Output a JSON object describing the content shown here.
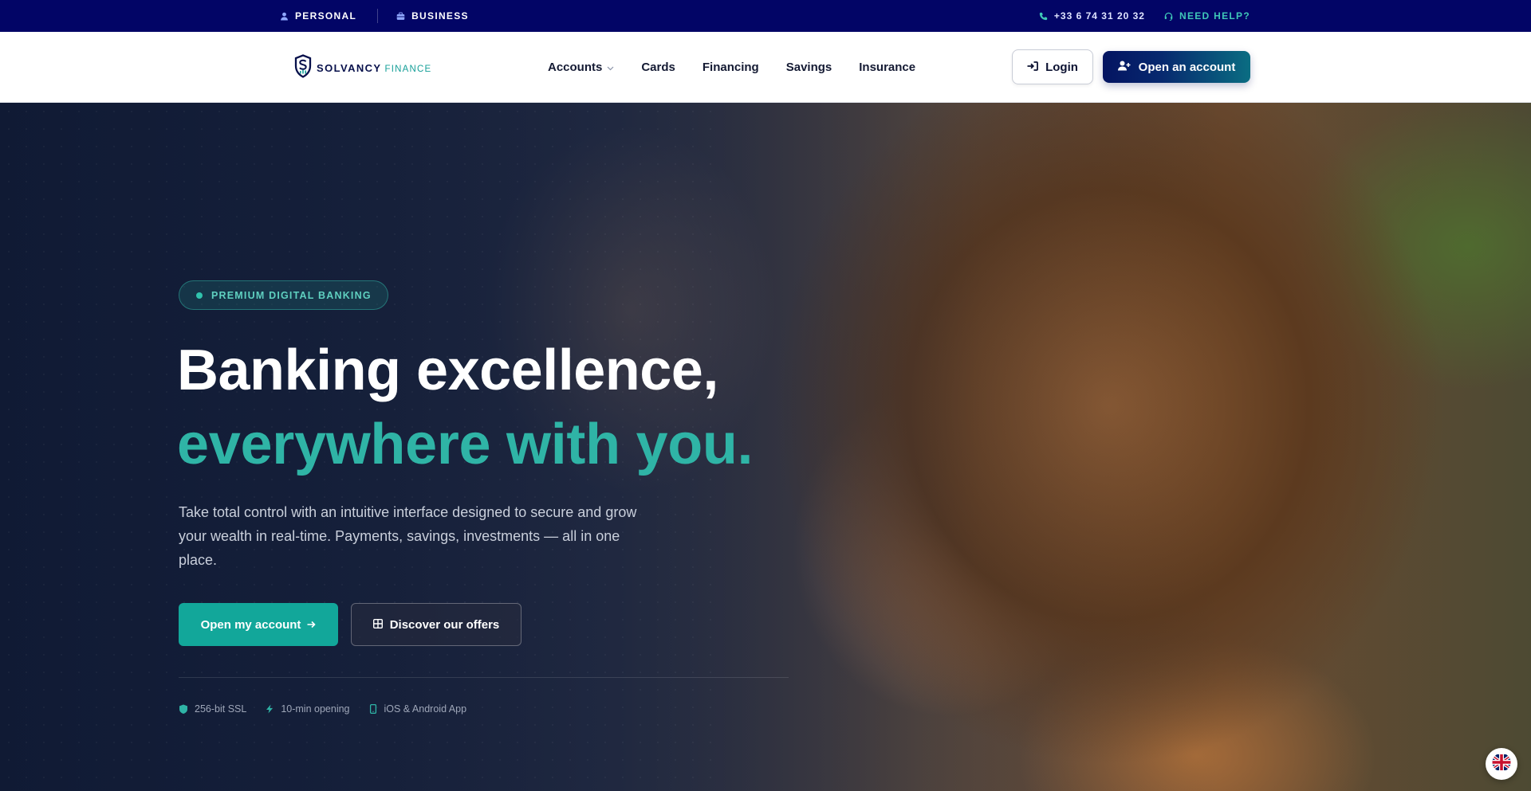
{
  "topbar": {
    "personal": "PERSONAL",
    "business": "BUSINESS",
    "phone": "+33 6 74 31 20 32",
    "help": "NEED HELP?"
  },
  "nav": {
    "logo_primary": "SOLVANCY",
    "logo_secondary": "FINANCE",
    "menu": [
      "Accounts",
      "Cards",
      "Financing",
      "Savings",
      "Insurance"
    ],
    "login": "Login",
    "open_account": "Open an account"
  },
  "hero": {
    "badge": "PREMIUM DIGITAL BANKING",
    "title_line1": "Banking excellence,",
    "title_line2": "everywhere with you.",
    "lead": "Take total control with an intuitive interface designed to secure and grow your wealth in real-time. Payments, savings, investments — all in one place.",
    "cta_primary": "Open my account",
    "cta_secondary": "Discover our offers",
    "features": [
      "256-bit SSL",
      "10-min opening",
      "iOS & Android App"
    ]
  },
  "icons": {
    "personal": "user-icon",
    "business": "briefcase-icon",
    "phone": "phone-icon",
    "help": "headset-icon",
    "login": "sign-in-icon",
    "open_account": "user-plus-icon",
    "cta_primary": "arrow-right-icon",
    "cta_secondary": "grid-icon",
    "features": [
      "shield-icon",
      "bolt-icon",
      "mobile-icon"
    ],
    "language": "uk-flag-icon"
  },
  "colors": {
    "topbar": "#020566",
    "accent": "#2fb4a6",
    "cta": "#12a79a",
    "brand_navy": "#07104b"
  }
}
